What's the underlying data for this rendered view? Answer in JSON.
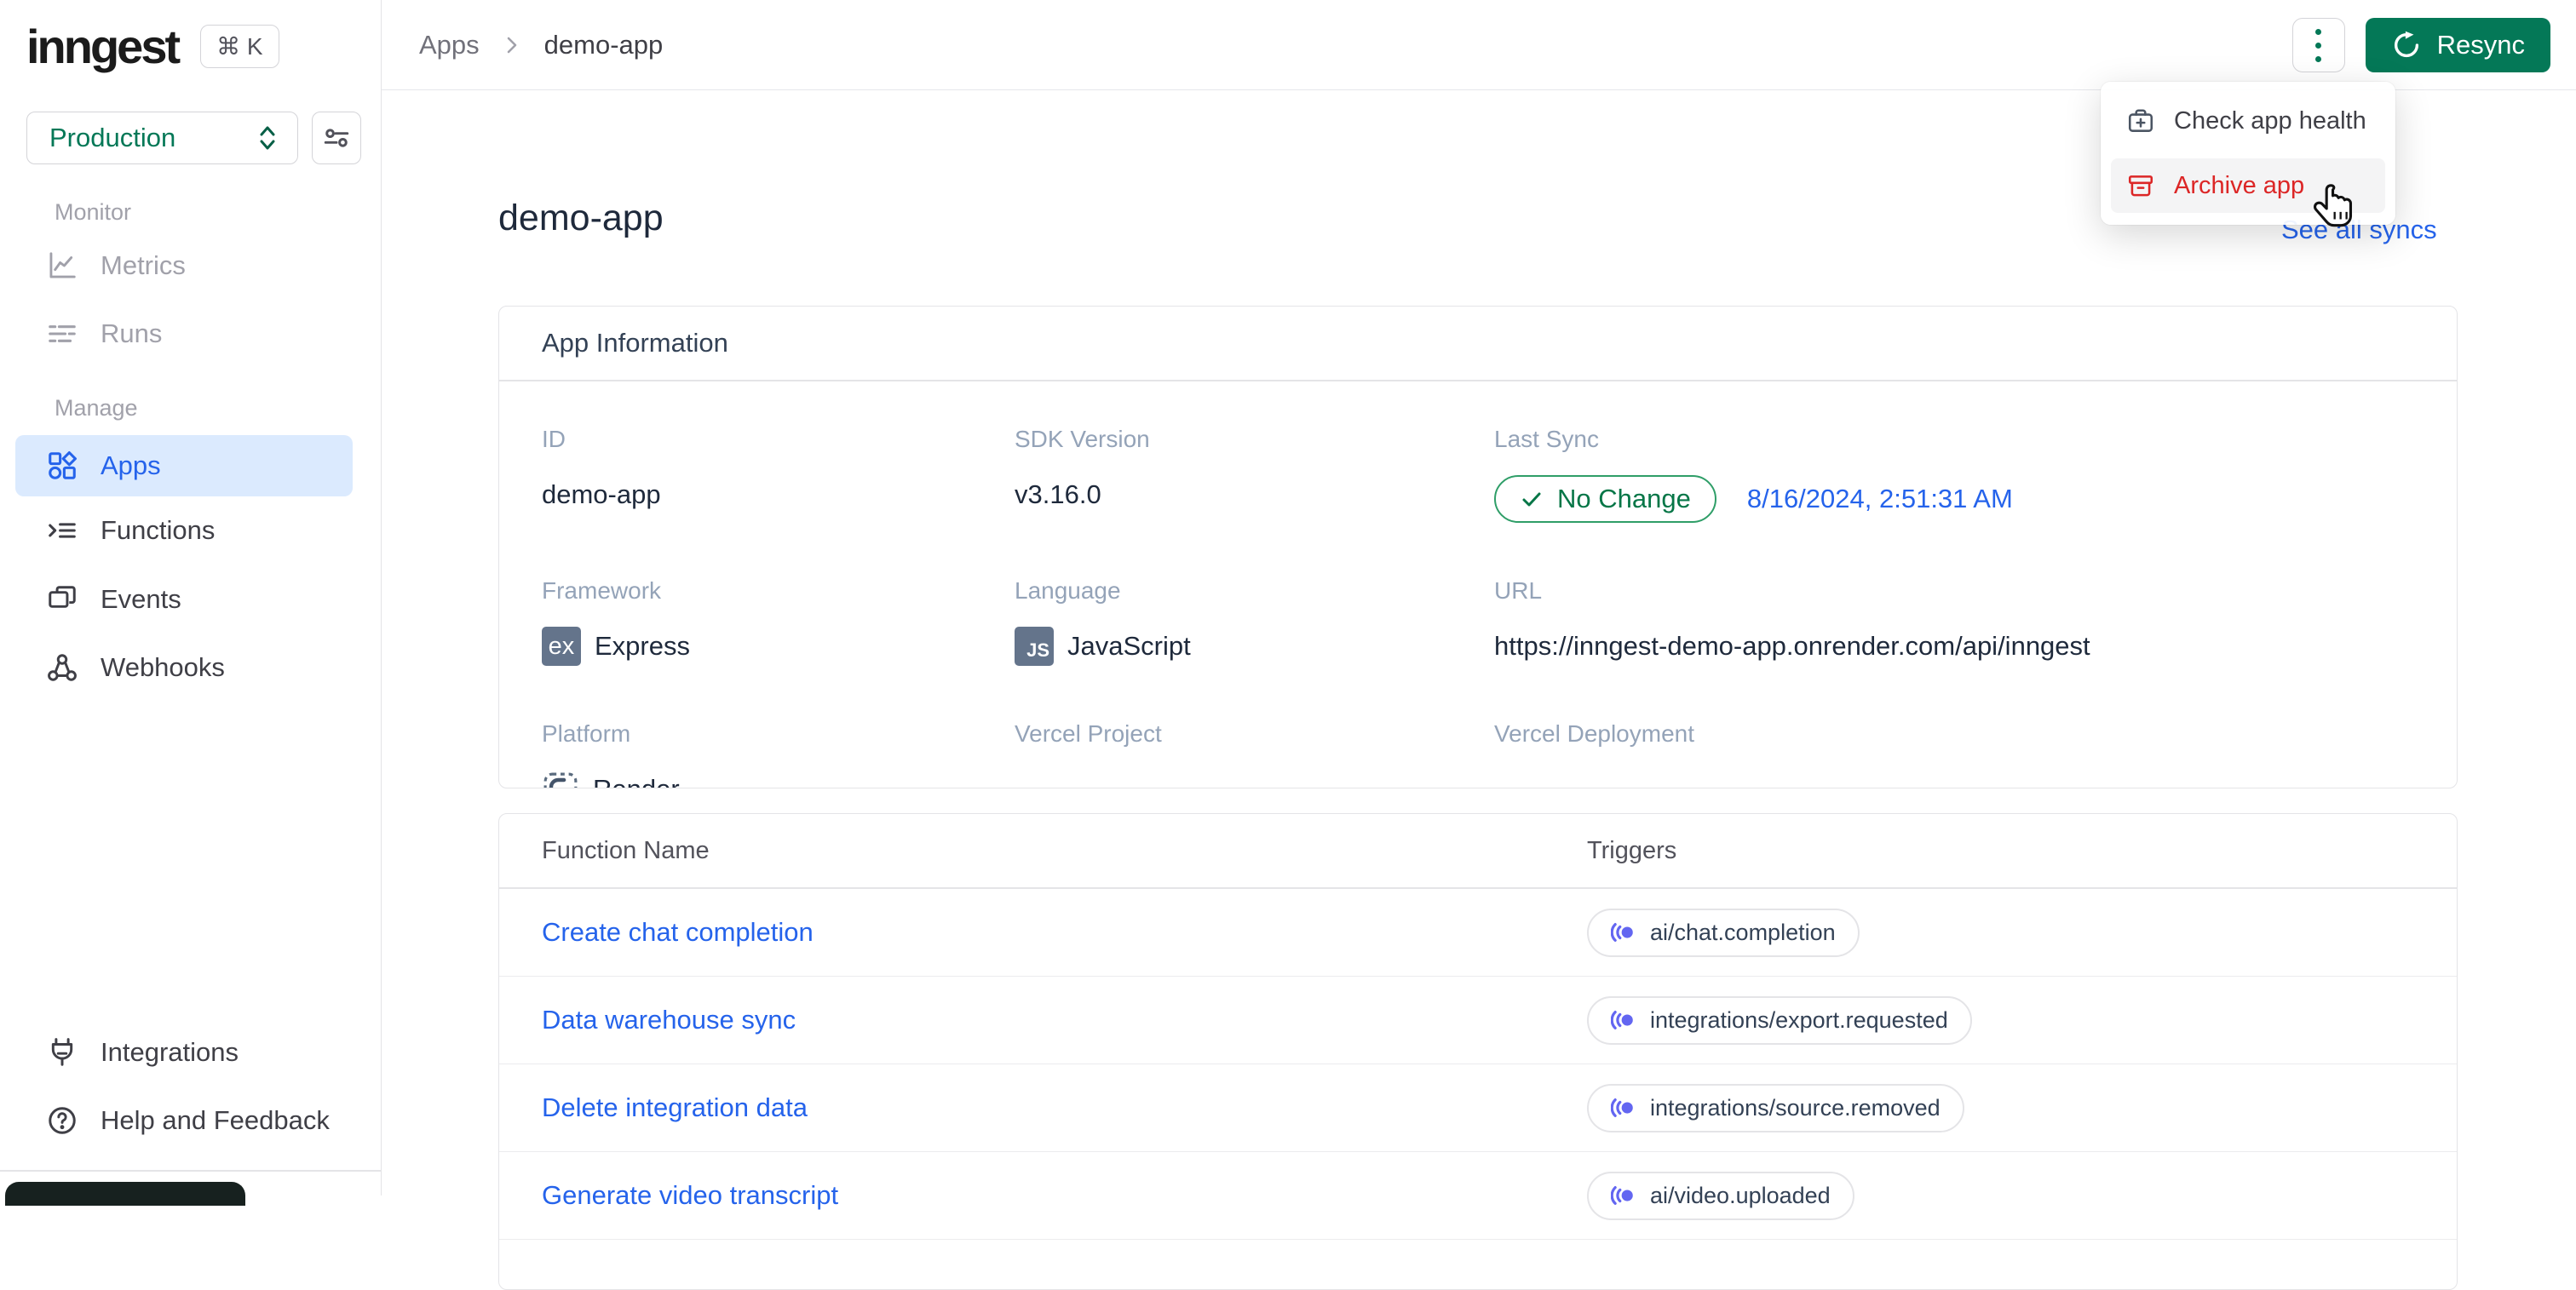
{
  "brand": {
    "logo_text": "inngest",
    "shortcut_label": "⌘ K"
  },
  "environment": {
    "selected": "Production"
  },
  "sidebar": {
    "sections": [
      {
        "label": "Monitor",
        "items": [
          {
            "label": "Metrics",
            "icon": "chart-line-icon",
            "state": "disabled"
          },
          {
            "label": "Runs",
            "icon": "runs-list-icon",
            "state": "disabled"
          }
        ]
      },
      {
        "label": "Manage",
        "items": [
          {
            "label": "Apps",
            "icon": "apps-shapes-icon",
            "state": "active"
          },
          {
            "label": "Functions",
            "icon": "functions-icon",
            "state": "default"
          },
          {
            "label": "Events",
            "icon": "events-icon",
            "state": "default"
          },
          {
            "label": "Webhooks",
            "icon": "webhooks-icon",
            "state": "default"
          }
        ]
      }
    ],
    "footer": [
      {
        "label": "Integrations",
        "icon": "plug-icon"
      },
      {
        "label": "Help and Feedback",
        "icon": "help-circle-icon"
      }
    ]
  },
  "topbar": {
    "breadcrumb": {
      "parent": "Apps",
      "current": "demo-app"
    },
    "resync": {
      "label": "Resync"
    }
  },
  "context_menu": {
    "items": [
      {
        "label": "Check app health",
        "icon": "health-kit-icon",
        "variant": "default"
      },
      {
        "label": "Archive app",
        "icon": "archive-box-icon",
        "variant": "danger",
        "hovered": true
      }
    ]
  },
  "page": {
    "title": "demo-app",
    "see_all_syncs_label": "See all syncs"
  },
  "app_info": {
    "card_title": "App Information",
    "id": {
      "label": "ID",
      "value": "demo-app"
    },
    "sdk": {
      "label": "SDK Version",
      "value": "v3.16.0"
    },
    "last_sync": {
      "label": "Last Sync",
      "status": "No Change",
      "timestamp": "8/16/2024, 2:51:31 AM"
    },
    "framework": {
      "label": "Framework",
      "value": "Express",
      "badge": "ex"
    },
    "language": {
      "label": "Language",
      "value": "JavaScript",
      "badge": "JS"
    },
    "url": {
      "label": "URL",
      "value": "https://inngest-demo-app.onrender.com/api/inngest"
    },
    "platform": {
      "label": "Platform",
      "value": "Render"
    },
    "vercel_project": {
      "label": "Vercel Project",
      "value": "-"
    },
    "vercel_deployment": {
      "label": "Vercel Deployment",
      "value": "-"
    }
  },
  "functions_table": {
    "headers": {
      "name": "Function Name",
      "triggers": "Triggers"
    },
    "rows": [
      {
        "name": "Create chat completion",
        "trigger": "ai/chat.completion"
      },
      {
        "name": "Data warehouse sync",
        "trigger": "integrations/export.requested"
      },
      {
        "name": "Delete integration data",
        "trigger": "integrations/source.removed"
      },
      {
        "name": "Generate video transcript",
        "trigger": "ai/video.uploaded"
      }
    ]
  },
  "colors": {
    "brand_green": "#047857",
    "link_blue": "#2563eb",
    "trigger_indigo": "#6366f1",
    "danger_red": "#dc2626",
    "status_green": "#067647",
    "active_item_bg": "#dbeafe"
  }
}
